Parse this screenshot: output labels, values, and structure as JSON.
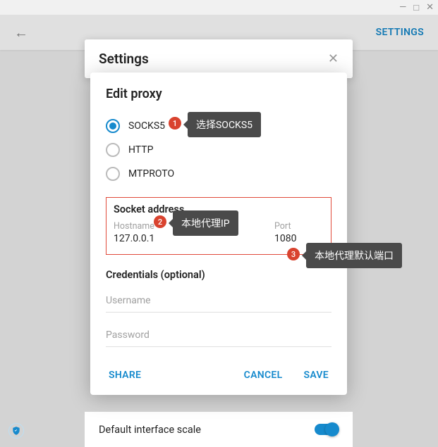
{
  "window": {
    "min": "—",
    "max": "□",
    "close": "✕"
  },
  "header": {
    "back": "←",
    "settings": "SETTINGS"
  },
  "settingsPanel": {
    "title": "Settings",
    "close": "✕"
  },
  "modal": {
    "title": "Edit proxy",
    "protocols": {
      "socks5": "SOCKS5",
      "http": "HTTP",
      "mtproto": "MTPROTO"
    },
    "socket": {
      "title": "Socket address",
      "hostname_label": "Hostname",
      "hostname_value": "127.0.0.1",
      "port_label": "Port",
      "port_value": "1080"
    },
    "credentials": {
      "title": "Credentials (optional)",
      "username_placeholder": "Username",
      "password_placeholder": "Password"
    },
    "actions": {
      "share": "SHARE",
      "cancel": "CANCEL",
      "save": "SAVE"
    }
  },
  "annotations": {
    "b1": "1",
    "t1": "选择SOCKS5",
    "b2": "2",
    "t2": "本地代理IP",
    "b3": "3",
    "t3": "本地代理默认端口"
  },
  "bottom": {
    "label": "Default interface scale"
  },
  "shield": "✔"
}
